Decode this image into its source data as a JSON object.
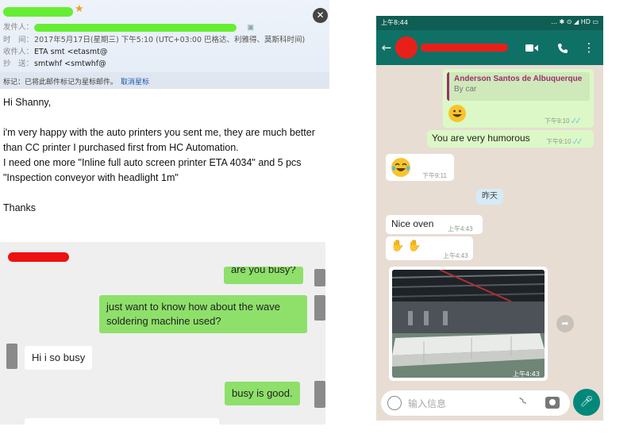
{
  "email": {
    "date_label": "时　间：",
    "date_value": "2017年5月17日(星期三) 下午5:10 (UTC+03:00 巴格达、利雅得、莫斯科时间)",
    "from_label": "发件人：",
    "to_label": "收件人：",
    "to_value": "ETA smt <etasmt@",
    "cc_label": "抄　送：",
    "cc_value": "smtwhf <smtwhf@",
    "mark_label": "标记：",
    "mark_text": "已将此邮件标记为星标邮件。",
    "unstar_link": "取消星标",
    "body": {
      "greeting": "Hi Shanny,",
      "line1": "i'm very happy with the auto printers you sent me, they are much better",
      "line2": "than CC printer I purchased first from HC Automation.",
      "line3": "I need one more \"Inline full auto screen printer ETA 4034\" and 5 pcs",
      "line4": "\"Inspection conveyor with headlight 1m\"",
      "closing": "Thanks"
    }
  },
  "wechat": {
    "msg_partial": "are you busy?",
    "msg1": "just want to know how about the wave soldering machine used?",
    "msg2": "Hi i so busy",
    "msg3": "busy is good."
  },
  "whatsapp": {
    "status_time": "上午8:44",
    "status_right": "... ✱ ⊙ ◢ HD ▭",
    "quote_author": "Anderson Santos de Albuquerque",
    "quote_text": "By car",
    "t1": "下午9:10",
    "msg_humorous": "You are very humorous",
    "t2": "下午9:10",
    "t3": "下午9:11",
    "date_chip": "昨天",
    "msg_oven": "Nice oven",
    "t4": "上午4:43",
    "t5": "上午4:43",
    "t6": "上午4:43",
    "input_placeholder": "输入信息",
    "colors": {
      "appbar": "#0f7066",
      "out_bubble": "#dcf8c6",
      "mic": "#00897b"
    }
  }
}
